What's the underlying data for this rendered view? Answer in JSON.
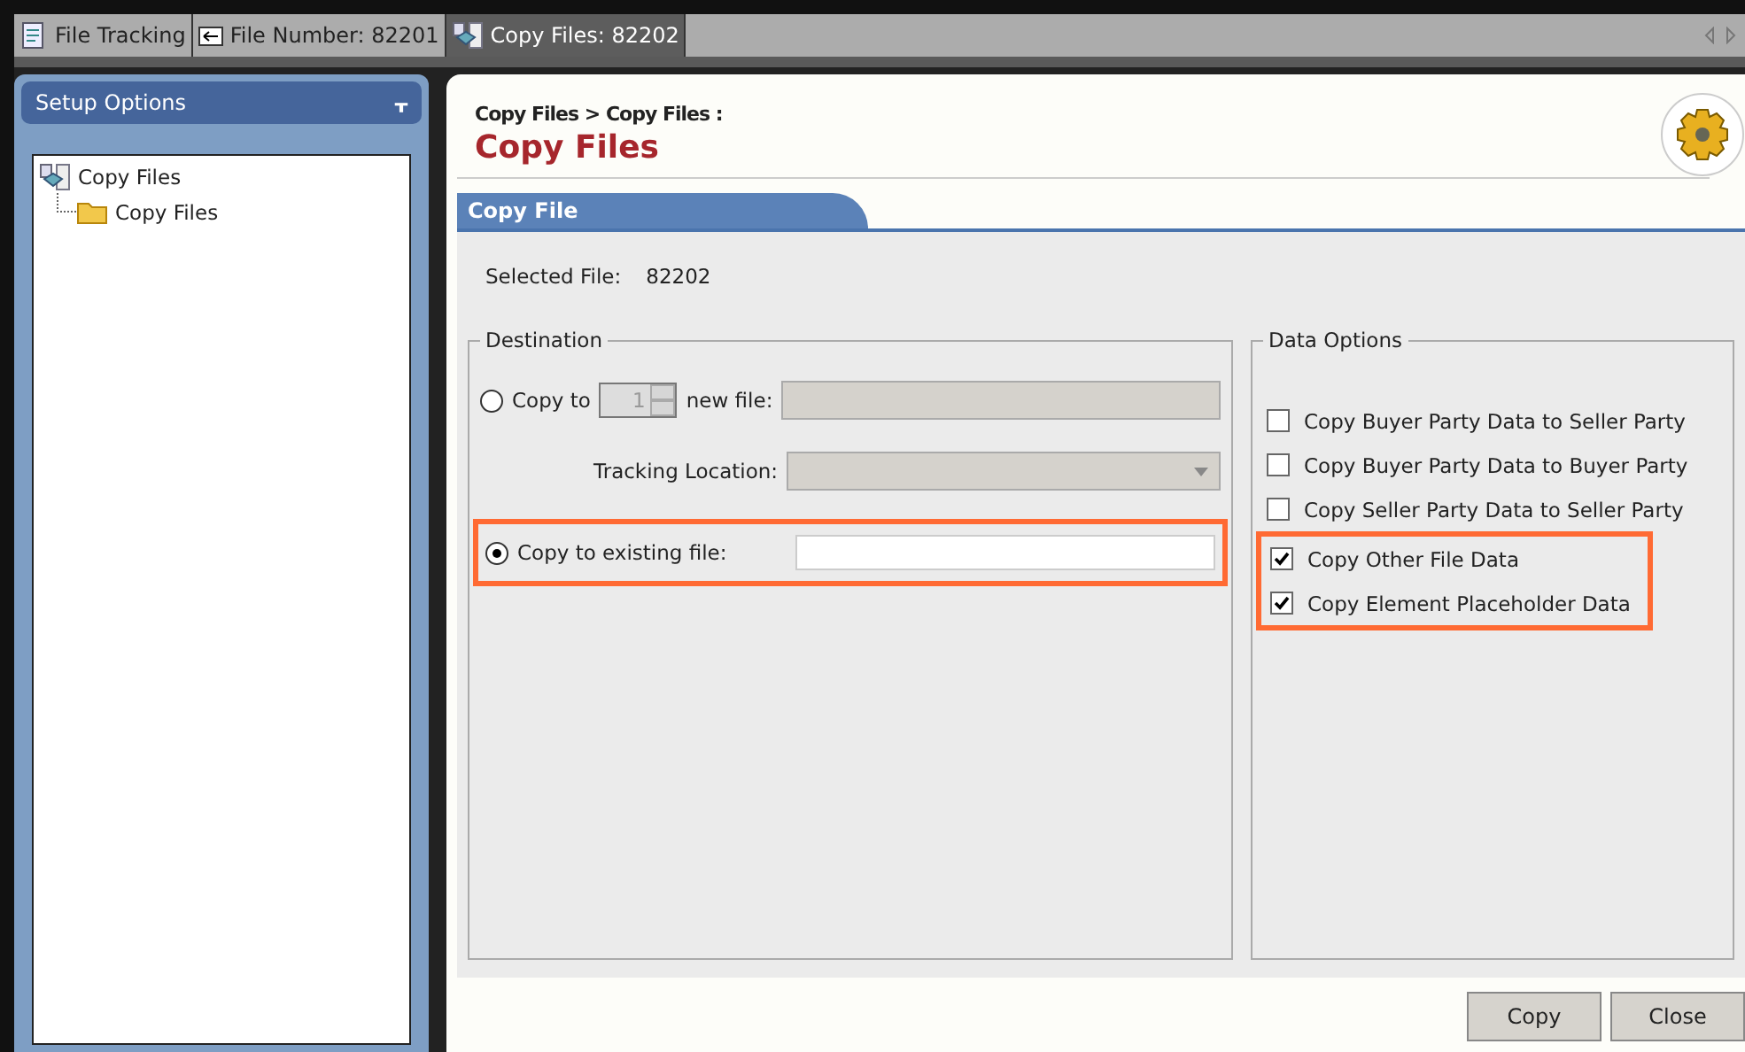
{
  "tabs": [
    {
      "label": "File Tracking",
      "selected": false
    },
    {
      "label": "File Number: 82201",
      "selected": false
    },
    {
      "label": "Copy Files: 82202",
      "selected": true
    }
  ],
  "sidebar": {
    "title": "Setup Options",
    "pin": "ᚁ",
    "tree": [
      {
        "label": "Copy Files",
        "children": [
          {
            "label": "Copy Files"
          }
        ]
      }
    ]
  },
  "page": {
    "breadcrumb": "Copy Files >  Copy Files :",
    "title": "Copy Files",
    "section": "Copy File",
    "selected_file_label": "Selected File:",
    "selected_file": "82202",
    "destination": {
      "legend": "Destination",
      "copy_new": {
        "label": "Copy to",
        "selected": false,
        "count": "1",
        "suffix": "new file:"
      },
      "tracking_label": "Tracking Location:",
      "copy_existing": {
        "label": "Copy to existing file:",
        "selected": true,
        "highlighted": true
      }
    },
    "data_options": {
      "legend": "Data Options",
      "options": [
        {
          "label": "Copy Buyer Party Data to Seller Party",
          "checked": false
        },
        {
          "label": "Copy Buyer Party Data to Buyer Party",
          "checked": false
        },
        {
          "label": "Copy Seller Party Data to Seller Party",
          "checked": false
        }
      ],
      "highlighted_options": [
        {
          "label": "Copy Other File Data",
          "checked": true
        },
        {
          "label": "Copy Element Placeholder Data",
          "checked": true
        }
      ]
    },
    "buttons": [
      "Copy",
      "Close"
    ]
  }
}
